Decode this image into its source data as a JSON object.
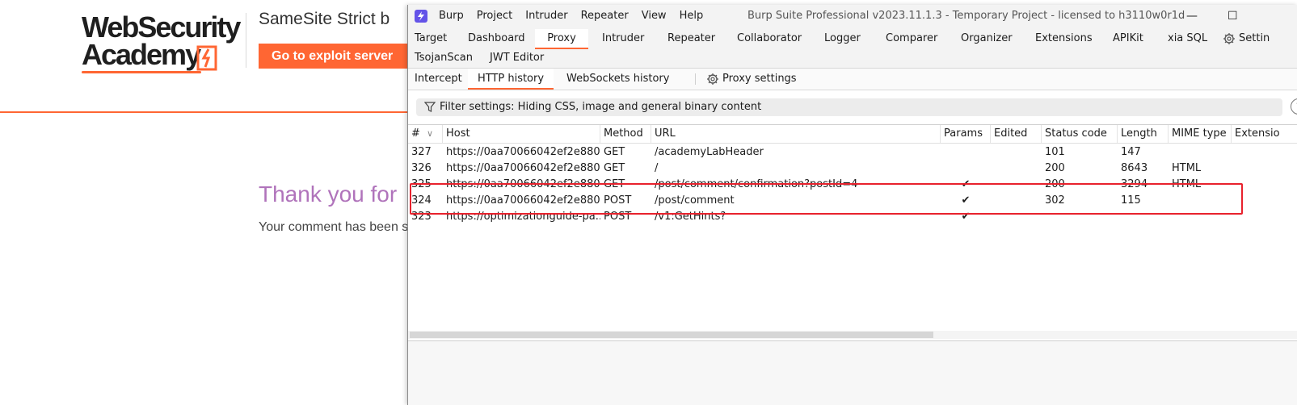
{
  "wsa": {
    "logo_line1": "WebSecurity",
    "logo_line2": "Academy",
    "lab_title": "SameSite Strict b",
    "exploit_button": "Go to exploit server",
    "thanks_heading": "Thank you for",
    "comment_note": "Your comment has been s",
    "brand_color": "#ff6633"
  },
  "burp": {
    "menu": [
      "Burp",
      "Project",
      "Intruder",
      "Repeater",
      "View",
      "Help"
    ],
    "window_title": "Burp Suite Professional v2023.11.1.3 - Temporary Project - licensed to h3110w0r1d",
    "window_controls": [
      "—",
      "☐"
    ],
    "main_tabs": [
      "Target",
      "Dashboard",
      "Proxy",
      "Intruder",
      "Repeater",
      "Collaborator",
      "Logger",
      "Comparer",
      "Organizer",
      "Extensions",
      "APIKit",
      "xia SQL",
      "Settin"
    ],
    "main_tabs_row2": [
      "TsojanScan",
      "JWT Editor"
    ],
    "active_main_tab": "Proxy",
    "sub_tabs": [
      "Intercept",
      "HTTP history",
      "WebSockets history"
    ],
    "active_sub_tab": "HTTP history",
    "proxy_settings_label": "Proxy settings",
    "filter_text": "Filter settings: Hiding CSS, image and general binary content",
    "help_glyph": "?",
    "columns": [
      "#",
      "Host",
      "Method",
      "URL",
      "Params",
      "Edited",
      "Status code",
      "Length",
      "MIME type",
      "Extensio"
    ],
    "sort_glyph": "∨",
    "rows": [
      {
        "num": "327",
        "host": "https://0aa70066042ef2e880...",
        "method": "GET",
        "url": "/academyLabHeader",
        "params": "",
        "edited": "",
        "status": "101",
        "length": "147",
        "mime": "",
        "ext": ""
      },
      {
        "num": "326",
        "host": "https://0aa70066042ef2e880...",
        "method": "GET",
        "url": "/",
        "params": "",
        "edited": "",
        "status": "200",
        "length": "8643",
        "mime": "HTML",
        "ext": ""
      },
      {
        "num": "325",
        "host": "https://0aa70066042ef2e880...",
        "method": "GET",
        "url": "/post/comment/confirmation?postId=4",
        "params": "✔",
        "edited": "",
        "status": "200",
        "length": "3294",
        "mime": "HTML",
        "ext": ""
      },
      {
        "num": "324",
        "host": "https://0aa70066042ef2e880...",
        "method": "POST",
        "url": "/post/comment",
        "params": "✔",
        "edited": "",
        "status": "302",
        "length": "115",
        "mime": "",
        "ext": ""
      },
      {
        "num": "323",
        "host": "https://optimizationguide-pa...",
        "method": "POST",
        "url": "/v1:GetHints?",
        "params": "✔",
        "edited": "",
        "status": "",
        "length": "",
        "mime": "",
        "ext": ""
      }
    ],
    "highlight_color": "#e8222d"
  }
}
